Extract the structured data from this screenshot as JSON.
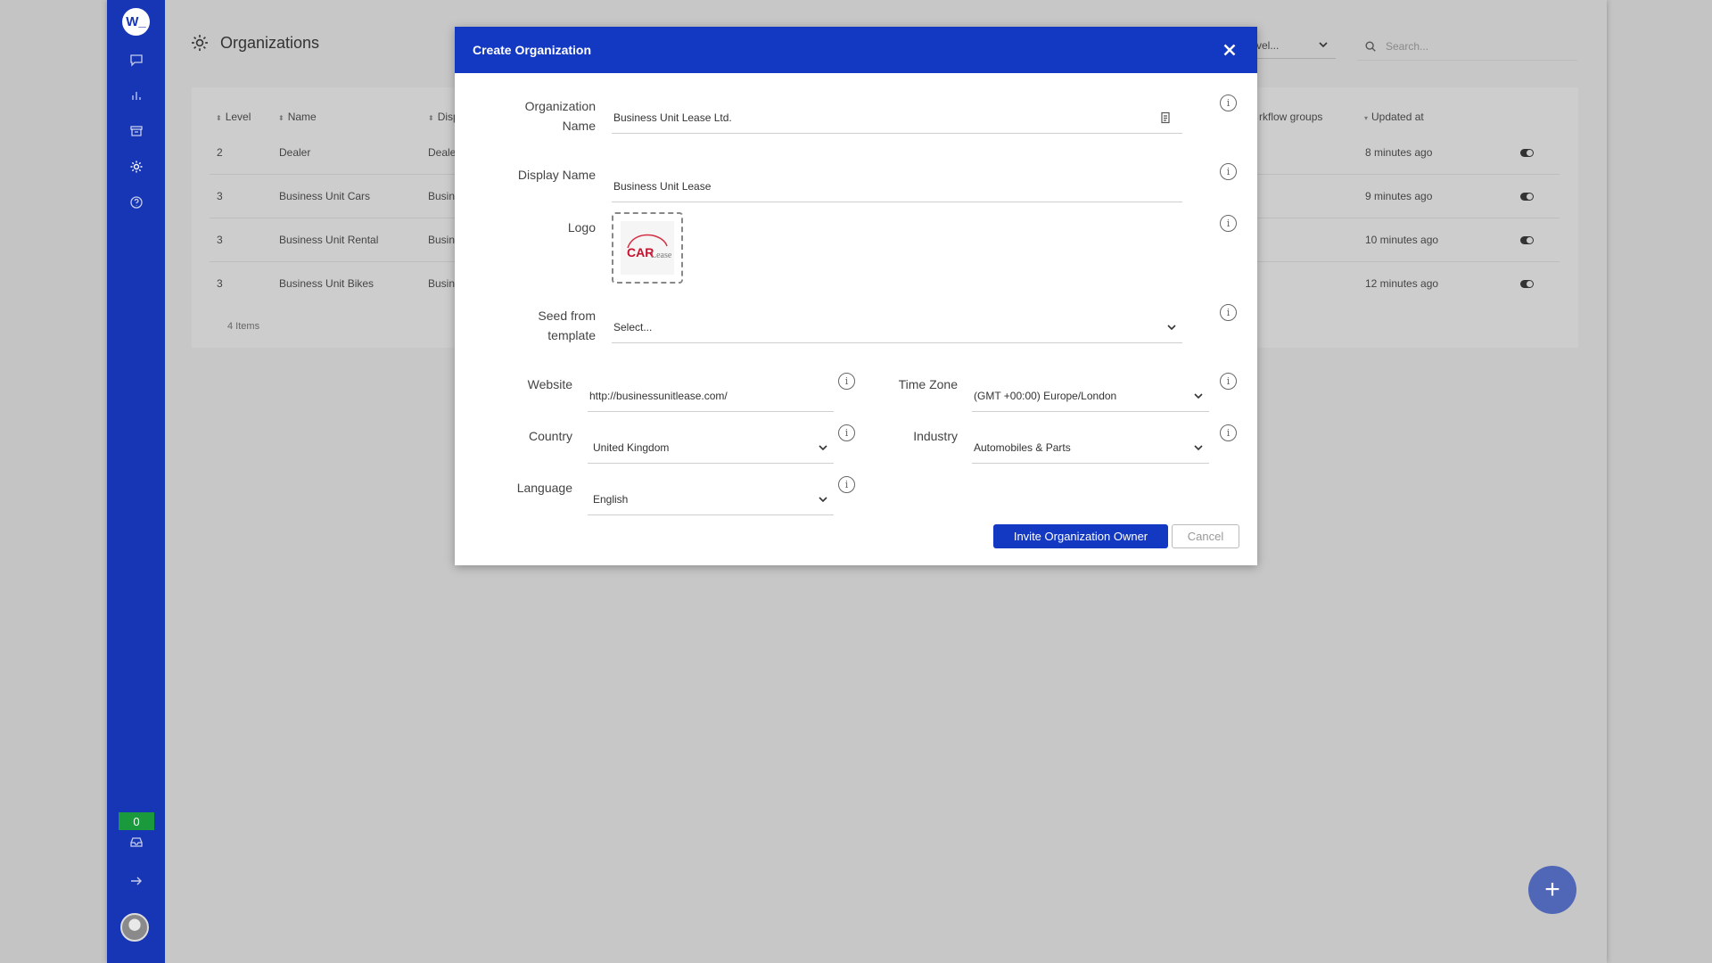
{
  "sidebar": {
    "logo_text": "W_",
    "icons": [
      "chat-icon",
      "chart-icon",
      "archive-icon",
      "gear-icon",
      "help-icon"
    ],
    "badge_count": "0",
    "inbox_icon": "inbox-icon",
    "logout_icon": "arrow-right-icon"
  },
  "header": {
    "title": "Organizations",
    "level_filter": "vel...",
    "search_placeholder": "Search..."
  },
  "table": {
    "columns": {
      "level": "Level",
      "name": "Name",
      "display": "Disp",
      "workflow": "rkflow groups",
      "updated": "Updated at"
    },
    "rows": [
      {
        "level": "2",
        "name": "Dealer",
        "display": "Deale",
        "updated": "8 minutes ago"
      },
      {
        "level": "3",
        "name": "Business Unit Cars",
        "display": "Busin",
        "updated": "9 minutes ago"
      },
      {
        "level": "3",
        "name": "Business Unit Rental",
        "display": "Busin",
        "updated": "10 minutes ago"
      },
      {
        "level": "3",
        "name": "Business Unit Bikes",
        "display": "Busin",
        "updated": "12 minutes ago"
      }
    ],
    "count": "4 Items"
  },
  "modal": {
    "title": "Create Organization",
    "org_name_label": "Organization Name",
    "org_name_value": "Business Unit Lease Ltd.",
    "display_name_label": "Display Name",
    "display_name_value": "Business Unit Lease",
    "logo_label": "Logo",
    "seed_label": "Seed from template",
    "seed_value": "Select...",
    "website_label": "Website",
    "website_value": "http://businessunitlease.com/",
    "timezone_label": "Time Zone",
    "timezone_value": "(GMT +00:00) Europe/London",
    "country_label": "Country",
    "country_value": "United Kingdom",
    "industry_label": "Industry",
    "industry_value": "Automobiles & Parts",
    "language_label": "Language",
    "language_value": "English",
    "invite_button": "Invite Organization Owner",
    "cancel_button": "Cancel"
  },
  "colors": {
    "brand": "#1338c2",
    "sidebar": "#1736b5",
    "badge": "#1a9a3c",
    "fab": "#5067b8"
  }
}
